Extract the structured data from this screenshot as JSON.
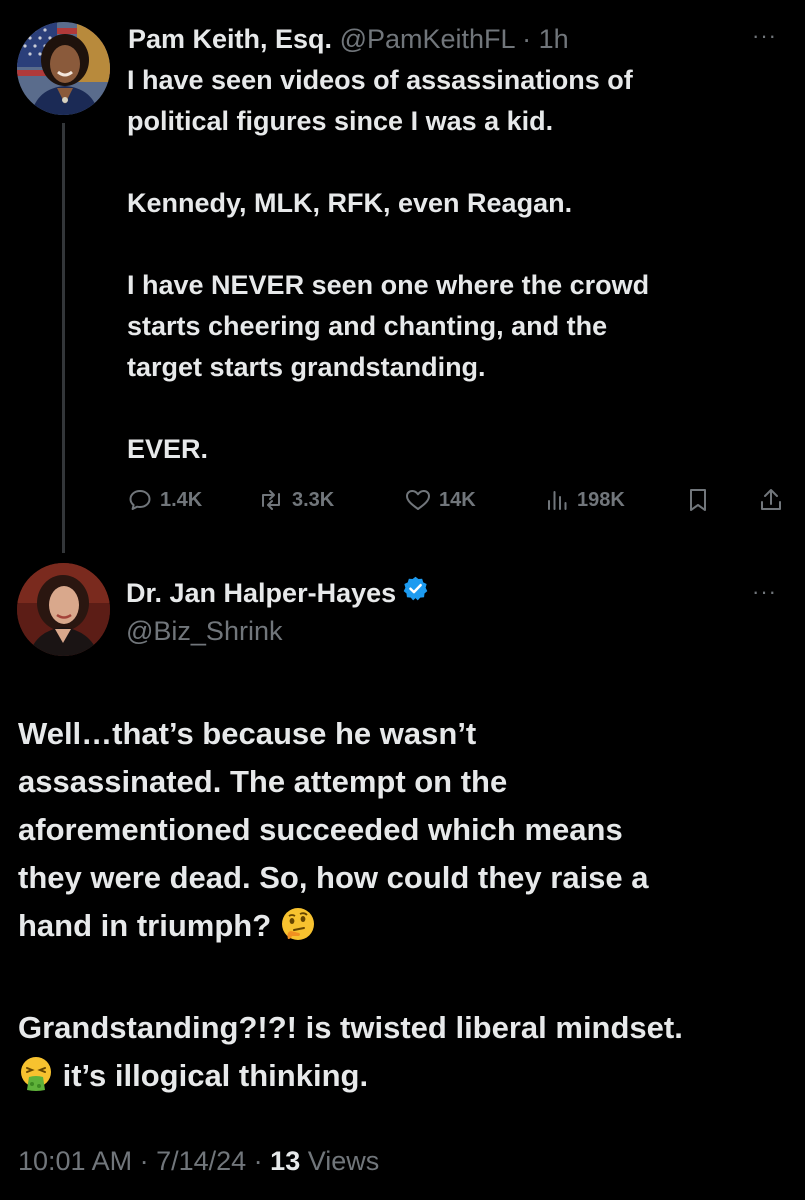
{
  "tweet1": {
    "author_name": "Pam Keith, Esq.",
    "handle": "@PamKeithFL",
    "separator": " · ",
    "age": "1h",
    "more": "···",
    "text_lines": [
      "I have seen videos of assassinations of",
      "political figures since  I was a kid.",
      "",
      "Kennedy, MLK, RFK, even Reagan.",
      "",
      "I have NEVER seen one where the crowd",
      "starts cheering and chanting, and the",
      "target starts grandstanding.",
      "",
      "EVER."
    ],
    "actions": {
      "replies": "1.4K",
      "retweets": "3.3K",
      "likes": "14K",
      "views": "198K"
    }
  },
  "tweet2": {
    "author_name": "Dr. Jan Halper-Hayes",
    "handle": "@Biz_Shrink",
    "verified": true,
    "more": "···",
    "text_lines": [
      "Well…that’s because he wasn’t",
      "assassinated. The attempt on the",
      "aforementioned succeeded which means",
      "they were dead. So, how could they raise a",
      "hand in triumph?",
      "",
      "Grandstanding?!?! is twisted liberal mindset.",
      "it’s illogical thinking."
    ],
    "time": "10:01 AM",
    "date": "7/14/24",
    "separator": " · ",
    "views_count": "13",
    "views_label": " Views"
  },
  "colors": {
    "background": "#000000",
    "text": "#e7e9ea",
    "muted": "#71767b",
    "verified_blue": "#1d9bf0",
    "thread_line": "#333639"
  },
  "icons": [
    "reply-icon",
    "retweet-icon",
    "like-icon",
    "views-icon",
    "bookmark-icon",
    "share-icon",
    "verified-badge-icon",
    "thinking-face-emoji",
    "vomiting-face-emoji"
  ]
}
